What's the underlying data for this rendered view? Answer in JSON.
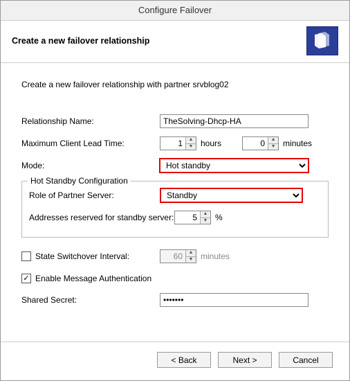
{
  "window": {
    "title": "Configure Failover"
  },
  "header": {
    "title": "Create a new failover relationship"
  },
  "intro": "Create a new failover relationship with partner srvblog02",
  "fields": {
    "relationship_name": {
      "label": "Relationship Name:",
      "value": "TheSolving-Dhcp-HA"
    },
    "mclt": {
      "label": "Maximum Client Lead Time:",
      "hours": "1",
      "hours_unit": "hours",
      "minutes": "0",
      "minutes_unit": "minutes"
    },
    "mode": {
      "label": "Mode:",
      "value": "Hot standby"
    },
    "group": {
      "legend": "Hot Standby Configuration",
      "role": {
        "label": "Role of Partner Server:",
        "value": "Standby"
      },
      "reserved": {
        "label": "Addresses reserved for standby server:",
        "value": "5",
        "unit": "%"
      }
    },
    "switchover": {
      "label": "State Switchover Interval:",
      "value": "60",
      "unit": "minutes",
      "checked": false
    },
    "auth": {
      "label": "Enable Message Authentication",
      "checked": true
    },
    "secret": {
      "label": "Shared Secret:",
      "value": "•••••••"
    }
  },
  "buttons": {
    "back": "< Back",
    "next": "Next >",
    "cancel": "Cancel"
  },
  "colors": {
    "highlight": "#e30000",
    "header_icon_bg": "#2a3f99"
  }
}
